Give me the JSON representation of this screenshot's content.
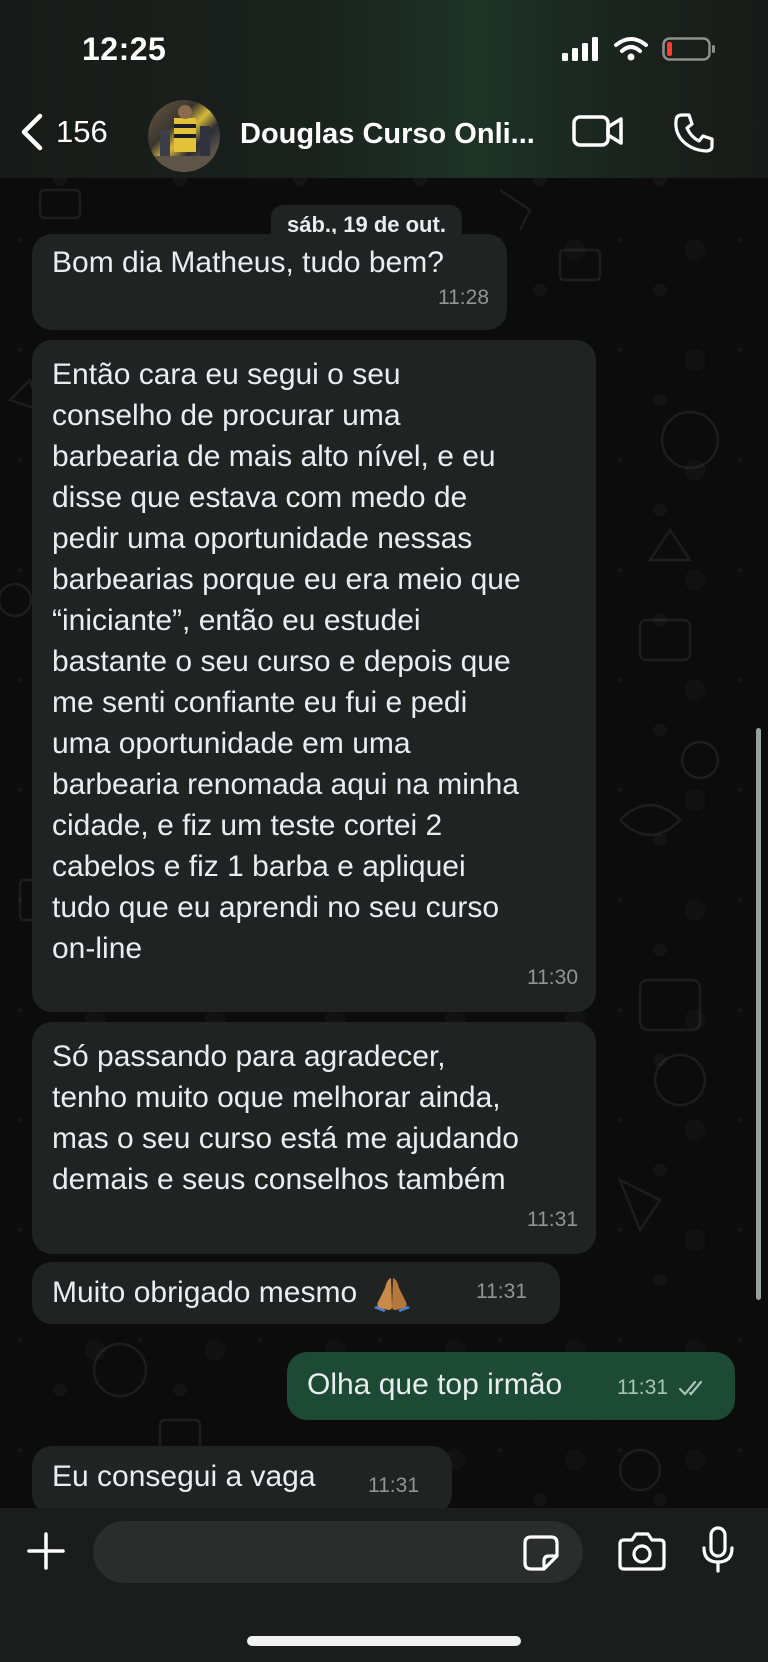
{
  "status_bar": {
    "time": "12:25"
  },
  "header": {
    "back_count": "156",
    "contact_name": "Douglas Curso Onli..."
  },
  "date_chip": "sáb., 19 de out.",
  "messages": [
    {
      "direction": "incoming",
      "text": "Bom dia Matheus, tudo bem?",
      "time": "11:28"
    },
    {
      "direction": "incoming",
      "text": "Então cara eu segui o seu\nconselho de procurar uma\nbarbearia de mais alto nível, e eu\ndisse que estava com medo de\npedir uma oportunidade nessas\nbarbearias porque eu era meio que\n“iniciante”, então eu estudei\nbastante o seu curso e depois que\nme senti confiante eu fui e pedi\numa oportunidade em uma\nbarbearia renomada aqui na minha\ncidade, e fiz um teste cortei 2\ncabelos e fiz 1 barba e apliquei\ntudo que eu aprendi no seu curso\non-line",
      "time": "11:30"
    },
    {
      "direction": "incoming",
      "text": "Só passando para agradecer,\ntenho muito oque melhorar ainda,\nmas o seu curso está me ajudando\ndemais e seus conselhos também",
      "time": "11:31"
    },
    {
      "direction": "incoming",
      "text": "Muito obrigado mesmo",
      "time": "11:31",
      "emoji": "folded-hands"
    },
    {
      "direction": "outgoing",
      "text": "Olha que top irmão",
      "time": "11:31",
      "status": "read"
    },
    {
      "direction": "incoming",
      "text": "Eu consegui a vaga",
      "time": "11:31"
    }
  ],
  "composer": {
    "input_value": "",
    "input_placeholder": ""
  },
  "colors": {
    "incoming_bubble": "#202322",
    "outgoing_bubble": "#1d4a34",
    "battery_low": "#ff3b30"
  },
  "icons": [
    "back-chevron-icon",
    "video-call-icon",
    "phone-icon",
    "plus-icon",
    "sticker-icon",
    "camera-icon",
    "microphone-icon",
    "double-check-icon",
    "signal-icon",
    "wifi-icon",
    "battery-icon"
  ]
}
